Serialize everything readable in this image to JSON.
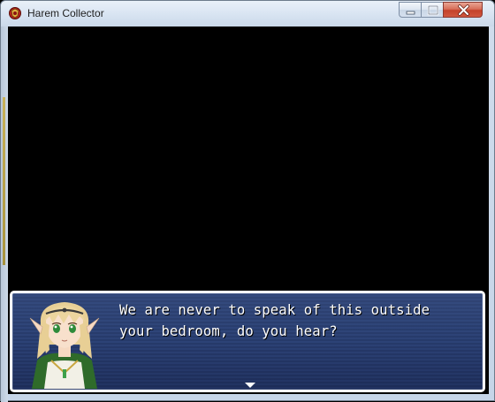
{
  "window": {
    "title": "Harem Collector",
    "icon": "red-emblem-icon",
    "controls": {
      "minimize": "minimize-icon",
      "maximize": "maximize-icon",
      "close": "close-icon"
    }
  },
  "dialogue": {
    "lines": [
      "We are never to speak of this outside",
      "your bedroom, do you hear?"
    ],
    "portrait": "elf-girl-portrait",
    "continue_indicator": "down-arrow-icon"
  },
  "colors": {
    "message_window": "#2a3f72",
    "message_border": "#ffffff",
    "text": "#ffffff",
    "screen": "#000000",
    "close_button": "#c4422a"
  }
}
